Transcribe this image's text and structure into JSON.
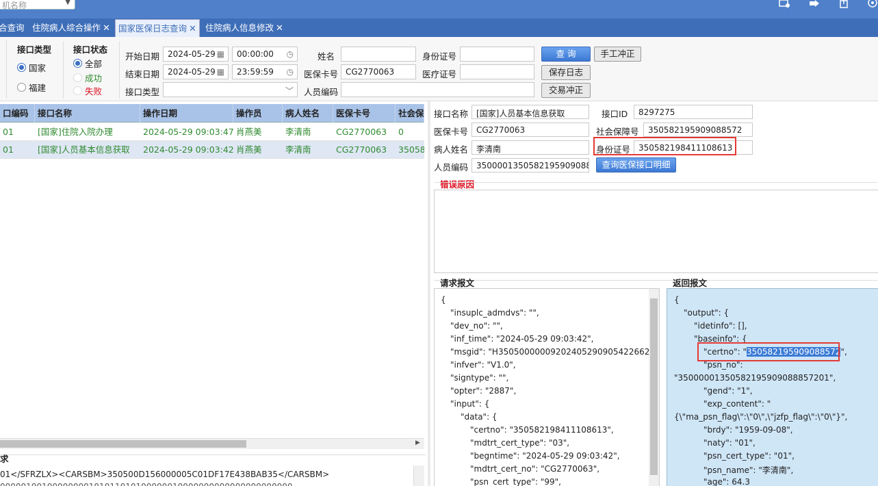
{
  "topbar": {
    "select_placeholder": "机名称",
    "icons": [
      "user-settings-icon",
      "forward-icon",
      "export-icon",
      "settings-icon"
    ]
  },
  "tabs": [
    {
      "label": "合查询",
      "closable": false
    },
    {
      "label": "住院病人综合操作",
      "closable": true
    },
    {
      "label": "国家医保日志查询",
      "closable": true,
      "active": true
    },
    {
      "label": "住院病人信息修改",
      "closable": true
    }
  ],
  "filters": {
    "interface_type": {
      "title": "接口类型",
      "options": [
        "国家",
        "福建"
      ],
      "selected": "国家"
    },
    "interface_status": {
      "title": "接口状态",
      "options": [
        "全部",
        "成功",
        "失败"
      ],
      "selected": "全部"
    },
    "start_date_label": "开始日期",
    "start_date": "2024-05-29",
    "start_time": "00:00:00",
    "end_date_label": "结束日期",
    "end_date": "2024-05-29",
    "end_time": "23:59:59",
    "iface_type_label": "接口类型",
    "iface_type_value": "",
    "name_label": "姓名",
    "name_value": "",
    "card_label": "医保卡号",
    "card_value": "CG2770063",
    "staff_code_label": "人员编码",
    "staff_code_value": "",
    "idcard_label": "身份证号",
    "idcard_value": "",
    "medcert_label": "医疗证号",
    "medcert_value": ""
  },
  "buttons": {
    "query": "查 询",
    "manual_correct": "手工冲正",
    "save_log": "保存日志",
    "tx_correct": "交易冲正",
    "query_detail": "查询医保接口明细"
  },
  "grid": {
    "columns": [
      "口编码",
      "接口名称",
      "操作日期",
      "操作员",
      "病人姓名",
      "医保卡号",
      "社会保"
    ],
    "rows": [
      [
        "01",
        "[国家]住院入院办理",
        "2024-05-29 09:03:47",
        "肖燕美",
        "李清南",
        "CG2770063",
        "0"
      ],
      [
        "01",
        "[国家]人员基本信息获取",
        "2024-05-29 09:03:42",
        "肖燕美",
        "李清南",
        "CG2770063",
        "35058"
      ]
    ],
    "selected_row": 1
  },
  "request_area": {
    "title": "求",
    "line1": "01</SFRZLX><CARSBM>350500D156000005C01DF17E438BAB35</CARSBM>",
    "line2": "00000100100000000101011010100000010000000000000000000000"
  },
  "detail": {
    "iface_name_label": "接口名称",
    "iface_name": "[国家]人员基本信息获取",
    "iface_id_label": "接口ID",
    "iface_id": "8297275",
    "card_label": "医保卡号",
    "card": "CG2770063",
    "social_label": "社会保障号",
    "social": "350582195909088572",
    "patient_label": "病人姓名",
    "patient": "李清南",
    "idcard_label": "身份证号",
    "idcard": "350582198411108613",
    "staff_label": "人员编码",
    "staff": "3500001350582195909088",
    "error_title": "错误原因",
    "request_title": "请求报文",
    "response_title": "返回报文"
  },
  "request_json_lines": [
    "{",
    "\"insuplc_admdvs\": \"\",",
    "\"dev_no\": \"\",",
    "\"inf_time\": \"2024-05-29 09:03:42\",",
    "\"msgid\": \"H35050000009202405290905422662\",",
    "\"infver\": \"V1.0\",",
    "\"signtype\": \"\",",
    "\"opter\": \"2887\",",
    "\"input\": {",
    "\"data\": {",
    "\"certno\": \"350582198411108613\",",
    "\"mdtrt_cert_type\": \"03\",",
    "\"begntime\": \"2024-05-29 09:03:42\",",
    "\"mdtrt_cert_no\": \"CG2770063\",",
    "\"psn_cert_type\": \"99\","
  ],
  "response_json": {
    "l0": "{",
    "l1": "\"output\": {",
    "l2": "\"idetinfo\": [],",
    "l3": "\"baseinfo\": {",
    "certno_key": "\"certno\": \"",
    "certno_value": "350582195909088572",
    "certno_tail": "\",",
    "l5": "\"psn_no\":",
    "l6": "\"35000001350582195909088857201\",",
    "l7": "\"gend\": \"1\",",
    "l8": "\"exp_content\": \"",
    "l9": "{\\\"ma_psn_flag\\\":\\\"0\\\",\\\"jzfp_flag\\\":\\\"0\\\"}\",",
    "l10": "\"brdy\": \"1959-09-08\",",
    "l11": "\"naty\": \"01\",",
    "l12": "\"psn_cert_type\": \"01\",",
    "l13": "\"psn_name\": \"李清南\",",
    "l14": "\"age\": 64.3"
  },
  "colors": {
    "topbar": "#4f80c9",
    "tabbar": "#3e6eb8",
    "grid_header": "#a9c3e8",
    "selected_row": "#dfe7f5",
    "ok_text": "#2f8a2f",
    "highlight_box": "#e53935",
    "response_bg": "#cfe6f7"
  }
}
